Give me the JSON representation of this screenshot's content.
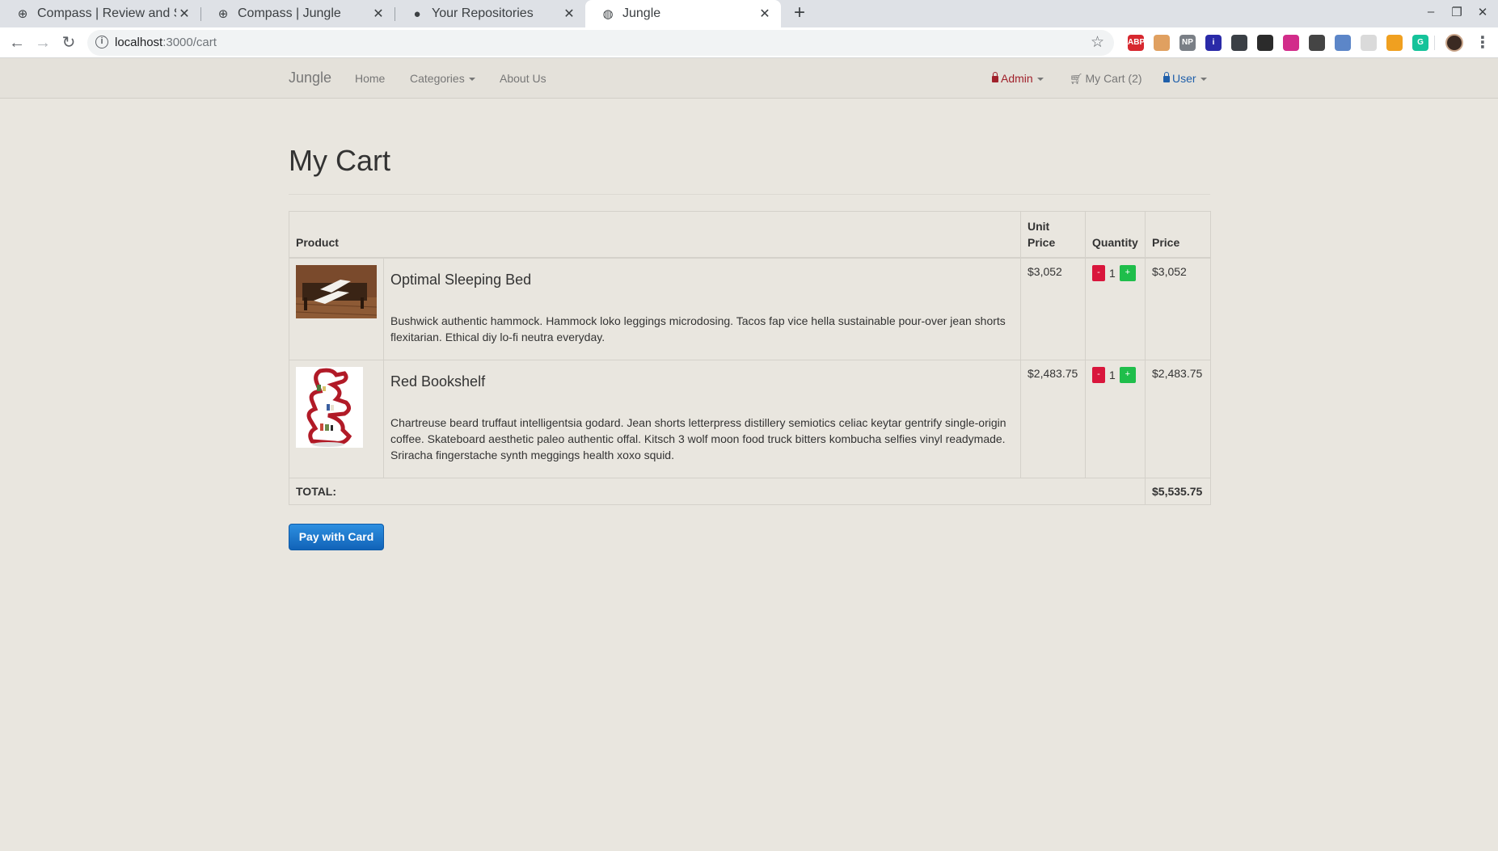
{
  "browser": {
    "tabs": [
      {
        "title": "Compass | Review and Su",
        "favicon": "compass-icon"
      },
      {
        "title": "Compass | Jungle",
        "favicon": "compass-icon"
      },
      {
        "title": "Your Repositories",
        "favicon": "github-icon"
      },
      {
        "title": "Jungle",
        "favicon": "globe-icon",
        "active": true
      }
    ],
    "url_host": "localhost",
    "url_path": ":3000/cart",
    "extensions": [
      {
        "name": "adblock-icon",
        "label": "ABP",
        "color": "#d7282f"
      },
      {
        "name": "face-icon",
        "label": "",
        "color": "#e0a060"
      },
      {
        "name": "np-icon",
        "label": "NP",
        "color": "#7a7f86"
      },
      {
        "name": "info-ext-icon",
        "label": "i",
        "color": "#2a2aa8"
      },
      {
        "name": "spy-icon",
        "label": "",
        "color": "#3a3f45"
      },
      {
        "name": "screen-icon",
        "label": "",
        "color": "#2b2b2b"
      },
      {
        "name": "moon-icon",
        "label": "",
        "color": "#d22c8a"
      },
      {
        "name": "circle-ext-icon",
        "label": "",
        "color": "#444"
      },
      {
        "name": "globe-ext-icon",
        "label": "",
        "color": "#5c86c8"
      },
      {
        "name": "blank-ext-icon",
        "label": "",
        "color": "#dadada"
      },
      {
        "name": "pen-icon",
        "label": "",
        "color": "#f0a020"
      },
      {
        "name": "grammarly-icon",
        "label": "G",
        "color": "#15c39a"
      }
    ]
  },
  "nav": {
    "brand": "Jungle",
    "home": "Home",
    "categories": "Categories",
    "about": "About Us",
    "admin": "Admin",
    "cart": "My Cart (2)",
    "user": "User",
    "admin_color": "#a0212b",
    "user_color": "#1f5faa"
  },
  "page": {
    "title": "My Cart"
  },
  "table": {
    "headers": {
      "product": "Product",
      "unit_price_line1": "Unit",
      "unit_price_line2": "Price",
      "quantity": "Quantity",
      "price": "Price"
    },
    "rows": [
      {
        "name": "Optimal Sleeping Bed",
        "description": "Bushwick authentic hammock. Hammock loko leggings microdosing. Tacos fap vice hella sustainable pour-over jean shorts flexitarian. Ethical diy lo-fi neutra everyday.",
        "unit_price": "$3,052",
        "quantity": "1",
        "price": "$3,052",
        "image": "bed-image"
      },
      {
        "name": "Red Bookshelf",
        "description": "Chartreuse beard truffaut intelligentsia godard. Jean shorts letterpress distillery semiotics celiac keytar gentrify single-origin coffee. Skateboard aesthetic paleo authentic offal. Kitsch 3 wolf moon food truck bitters kombucha selfies vinyl readymade. Sriracha fingerstache synth meggings health xoxo squid.",
        "unit_price": "$2,483.75",
        "quantity": "1",
        "price": "$2,483.75",
        "image": "bookshelf-image"
      }
    ],
    "minus_label": "-",
    "plus_label": "+",
    "total_label": "TOTAL:",
    "total_value": "$5,535.75"
  },
  "pay_button": "Pay with Card"
}
